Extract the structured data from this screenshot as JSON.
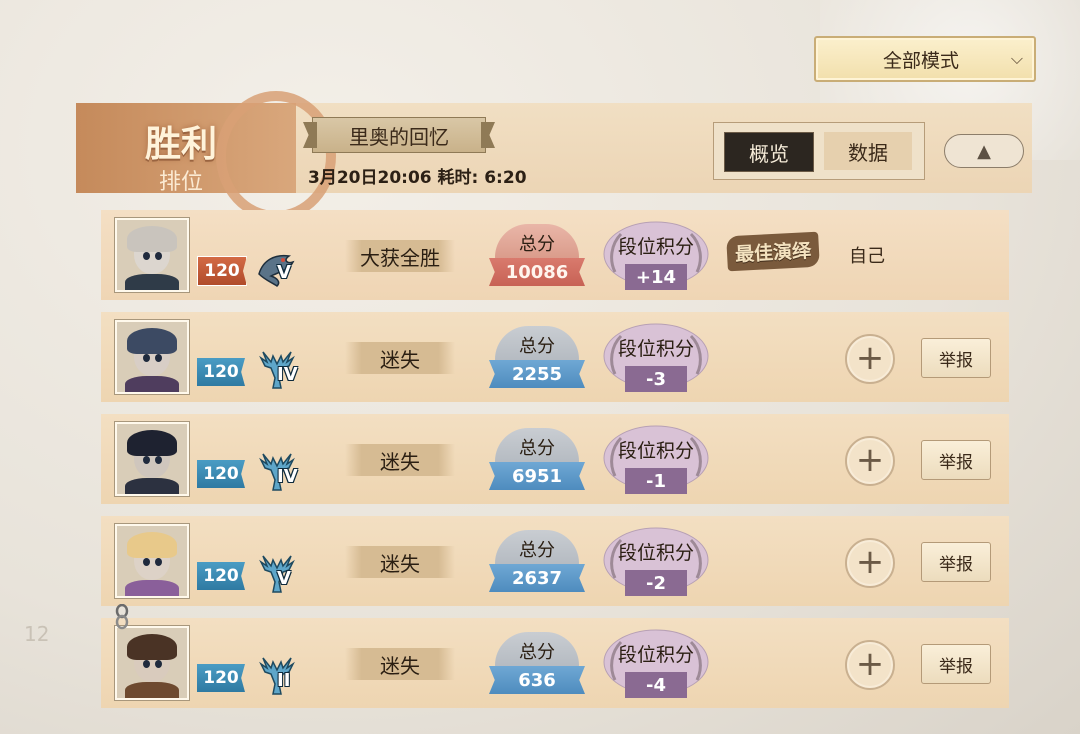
{
  "mode_dropdown": {
    "label": "全部模式"
  },
  "header": {
    "result": "胜利",
    "result_sub": "排位",
    "map_name": "里奥的回忆",
    "match_info": "3月20日20:06  耗时: 6:20",
    "tabs": [
      {
        "label": "概览",
        "active": true
      },
      {
        "label": "数据",
        "active": false
      }
    ]
  },
  "labels": {
    "total_score": "总分",
    "rank_points": "段位积分",
    "report": "举报",
    "self": "自己",
    "best": "最佳演绎"
  },
  "players": [
    {
      "level": "120",
      "level_color": "#c4562f",
      "rank_icon": "dragon-rank-icon",
      "rank_tier": "V",
      "status": "大获全胜",
      "total": "10086",
      "delta": "+14",
      "self": true
    },
    {
      "level": "120",
      "level_color": "#2f7aa2",
      "rank_icon": "deer-rank-icon",
      "rank_tier": "IV",
      "status": "迷失",
      "total": "2255",
      "delta": "-3",
      "self": false
    },
    {
      "level": "120",
      "level_color": "#2f7aa2",
      "rank_icon": "deer-rank-icon",
      "rank_tier": "IV",
      "status": "迷失",
      "total": "6951",
      "delta": "-1",
      "self": false
    },
    {
      "level": "120",
      "level_color": "#2f7aa2",
      "rank_icon": "deer-rank-icon",
      "rank_tier": "V",
      "status": "迷失",
      "total": "2637",
      "delta": "-2",
      "self": false
    },
    {
      "level": "120",
      "level_color": "#2f7aa2",
      "rank_icon": "deer-rank-icon",
      "rank_tier": "II",
      "status": "迷失",
      "total": "636",
      "delta": "-4",
      "self": false
    }
  ],
  "colors": {
    "accent": "#c58a5b",
    "score_self": "#d97a6d",
    "score_other": "#4e8cbe",
    "delta_bg": "#8a6a92"
  },
  "background": {
    "side_number": "12"
  }
}
